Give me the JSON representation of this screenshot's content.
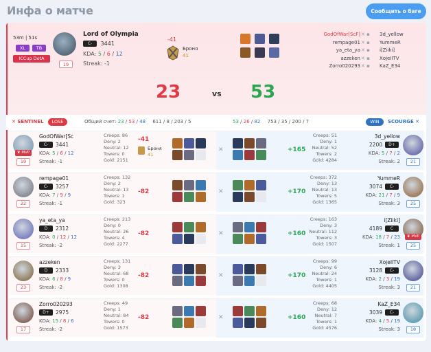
{
  "header": {
    "title": "Инфа о матче",
    "report_button": "Сообщить о баге"
  },
  "match": {
    "time": "53m | 51s",
    "badge_xl": "XL",
    "badge_tb": "TB",
    "league": "ICCup DotA",
    "hero_level": "19",
    "player": "Lord of Olympia",
    "rank": "C-",
    "rating": "3441",
    "kda_label": "KDA:",
    "kda_k": "5",
    "kda_d": "6",
    "kda_a": "12",
    "streak": "Streak: -1",
    "delta": "-41",
    "armor_label": "Броня",
    "armor_value": "41",
    "score_left": "23",
    "vs": "vs",
    "score_right": "53"
  },
  "sidebar_players": {
    "left": [
      "GodOfWar[ScF]",
      "rempage01",
      "ya_eta_ya",
      "azzeken",
      "Zorro020293"
    ],
    "right": [
      "3d_yellow",
      "YummeR",
      "i[Ziiki]",
      "XojeIITV",
      "KaZ_E34"
    ]
  },
  "teams": {
    "sentinel": "SENTINEL",
    "lose": "LOSE",
    "total_label": "Общий счет:",
    "left_total": {
      "a": "23",
      "b": "53",
      "c": "48"
    },
    "left_nums": "611 / 8 / 203 / 5",
    "right_total": {
      "a": "53",
      "b": "26",
      "c": "82"
    },
    "right_nums": "753 / 35 / 200 / 7",
    "win": "WIN",
    "scourge": "SCOURGE"
  },
  "rows": [
    {
      "l_name": "GodOfWar[Sc",
      "l_rank": "C-",
      "l_rating": "3441",
      "l_kda": [
        "5",
        "6",
        "12"
      ],
      "l_streak": "Streak: -1",
      "l_level": "19",
      "l_mvp": "MVP",
      "l_creeps": "Creeps: 86",
      "l_deny": "Deny: 2",
      "l_neutral": "Neutral: 12",
      "l_towers": "Towers: 0",
      "l_gold": "Gold: 2151",
      "l_delta": "-41",
      "l_armor": "Броня",
      "l_armor_v": "41",
      "r_delta": "+165",
      "r_creeps": "Creeps: 51",
      "r_deny": "Deny: 1",
      "r_neutral": "Neutral: 52",
      "r_towers": "Towers: 2",
      "r_gold": "Gold: 4284",
      "r_name": "3d_yellow",
      "r_rating": "2200",
      "r_rank": "D+",
      "r_kda": [
        "5",
        "7",
        "2"
      ],
      "r_streak": "Streak: 2",
      "r_level": "21",
      "r_mvp": ""
    },
    {
      "l_name": "rempage01",
      "l_rank": "C-",
      "l_rating": "3257",
      "l_kda": [
        "7",
        "9",
        "9"
      ],
      "l_streak": "Streak: -1",
      "l_level": "22",
      "l_mvp": "",
      "l_creeps": "Creeps: 132",
      "l_deny": "Deny: 2",
      "l_neutral": "Neutral: 13",
      "l_towers": "Towers: 1",
      "l_gold": "Gold: 323",
      "l_delta": "-82",
      "r_delta": "+170",
      "r_creeps": "Creeps: 372",
      "r_deny": "Deny: 13",
      "r_neutral": "Neutral: 13",
      "r_towers": "Towers: 5",
      "r_gold": "Gold: 1365",
      "r_name": "YummeR",
      "r_rating": "3074",
      "r_rank": "C-",
      "r_kda": [
        "21",
        "7",
        "9"
      ],
      "r_streak": "Streak: 3",
      "r_level": "25",
      "r_mvp": ""
    },
    {
      "l_name": "ya_eta_ya",
      "l_rank": "D",
      "l_rating": "2312",
      "l_kda": [
        "0",
        "12",
        "12"
      ],
      "l_streak": "Streak: -2",
      "l_level": "15",
      "l_mvp": "",
      "l_creeps": "Creeps: 213",
      "l_deny": "Deny: 0",
      "l_neutral": "Neutral: 26",
      "l_towers": "Towers: 4",
      "l_gold": "Gold: 2277",
      "l_delta": "-82",
      "r_delta": "+160",
      "r_creeps": "Creeps: 163",
      "r_deny": "Deny: 3",
      "r_neutral": "Neutral: 112",
      "r_towers": "Towers: 3",
      "r_gold": "Gold: 1507",
      "r_name": "i[Ziiki]",
      "r_rating": "4189",
      "r_rank": "C",
      "r_kda": [
        "18",
        "7",
        "23"
      ],
      "r_streak": "Streak: 1",
      "r_level": "25",
      "r_mvp": "MVP"
    },
    {
      "l_name": "azzeken",
      "l_rank": "D",
      "l_rating": "2333",
      "l_kda": [
        "6",
        "8",
        "9"
      ],
      "l_streak": "Streak: -2",
      "l_level": "23",
      "l_mvp": "",
      "l_creeps": "Creeps: 131",
      "l_deny": "Deny: 3",
      "l_neutral": "Neutral: 68",
      "l_towers": "Towers: 0",
      "l_gold": "Gold: 1308",
      "l_delta": "-82",
      "r_delta": "+170",
      "r_creeps": "Creeps: 99",
      "r_deny": "Deny: 6",
      "r_neutral": "Neutral: 24",
      "r_towers": "Towers: 1",
      "r_gold": "Gold: 4405",
      "r_name": "XojeIITV",
      "r_rating": "3128",
      "r_rank": "C-",
      "r_kda": [
        "2",
        "3",
        "19"
      ],
      "r_streak": "Streak: 3",
      "r_level": "21",
      "r_mvp": ""
    },
    {
      "l_name": "Zorro020293",
      "l_rank": "D+",
      "l_rating": "2975",
      "l_kda": [
        "15",
        "8",
        "6"
      ],
      "l_streak": "Streak: -2",
      "l_level": "17",
      "l_mvp": "",
      "l_creeps": "Creeps: 49",
      "l_deny": "Deny: 1",
      "l_neutral": "Neutral: 84",
      "l_towers": "Towers: 0",
      "l_gold": "Gold: 1573",
      "l_delta": "-82",
      "r_delta": "+160",
      "r_creeps": "Creeps: 68",
      "r_deny": "Deny: 12",
      "r_neutral": "Neutral: 7",
      "r_towers": "Towers: 1",
      "r_gold": "Gold: 4576",
      "r_name": "KaZ_E34",
      "r_rating": "3039",
      "r_rank": "C-",
      "r_kda": [
        "4",
        "5",
        "19"
      ],
      "r_streak": "Streak: 3",
      "r_level": "18",
      "r_mvp": ""
    }
  ],
  "colors": {
    "accent": "#4a9df0",
    "red": "#e03a45",
    "green": "#2aa651"
  }
}
